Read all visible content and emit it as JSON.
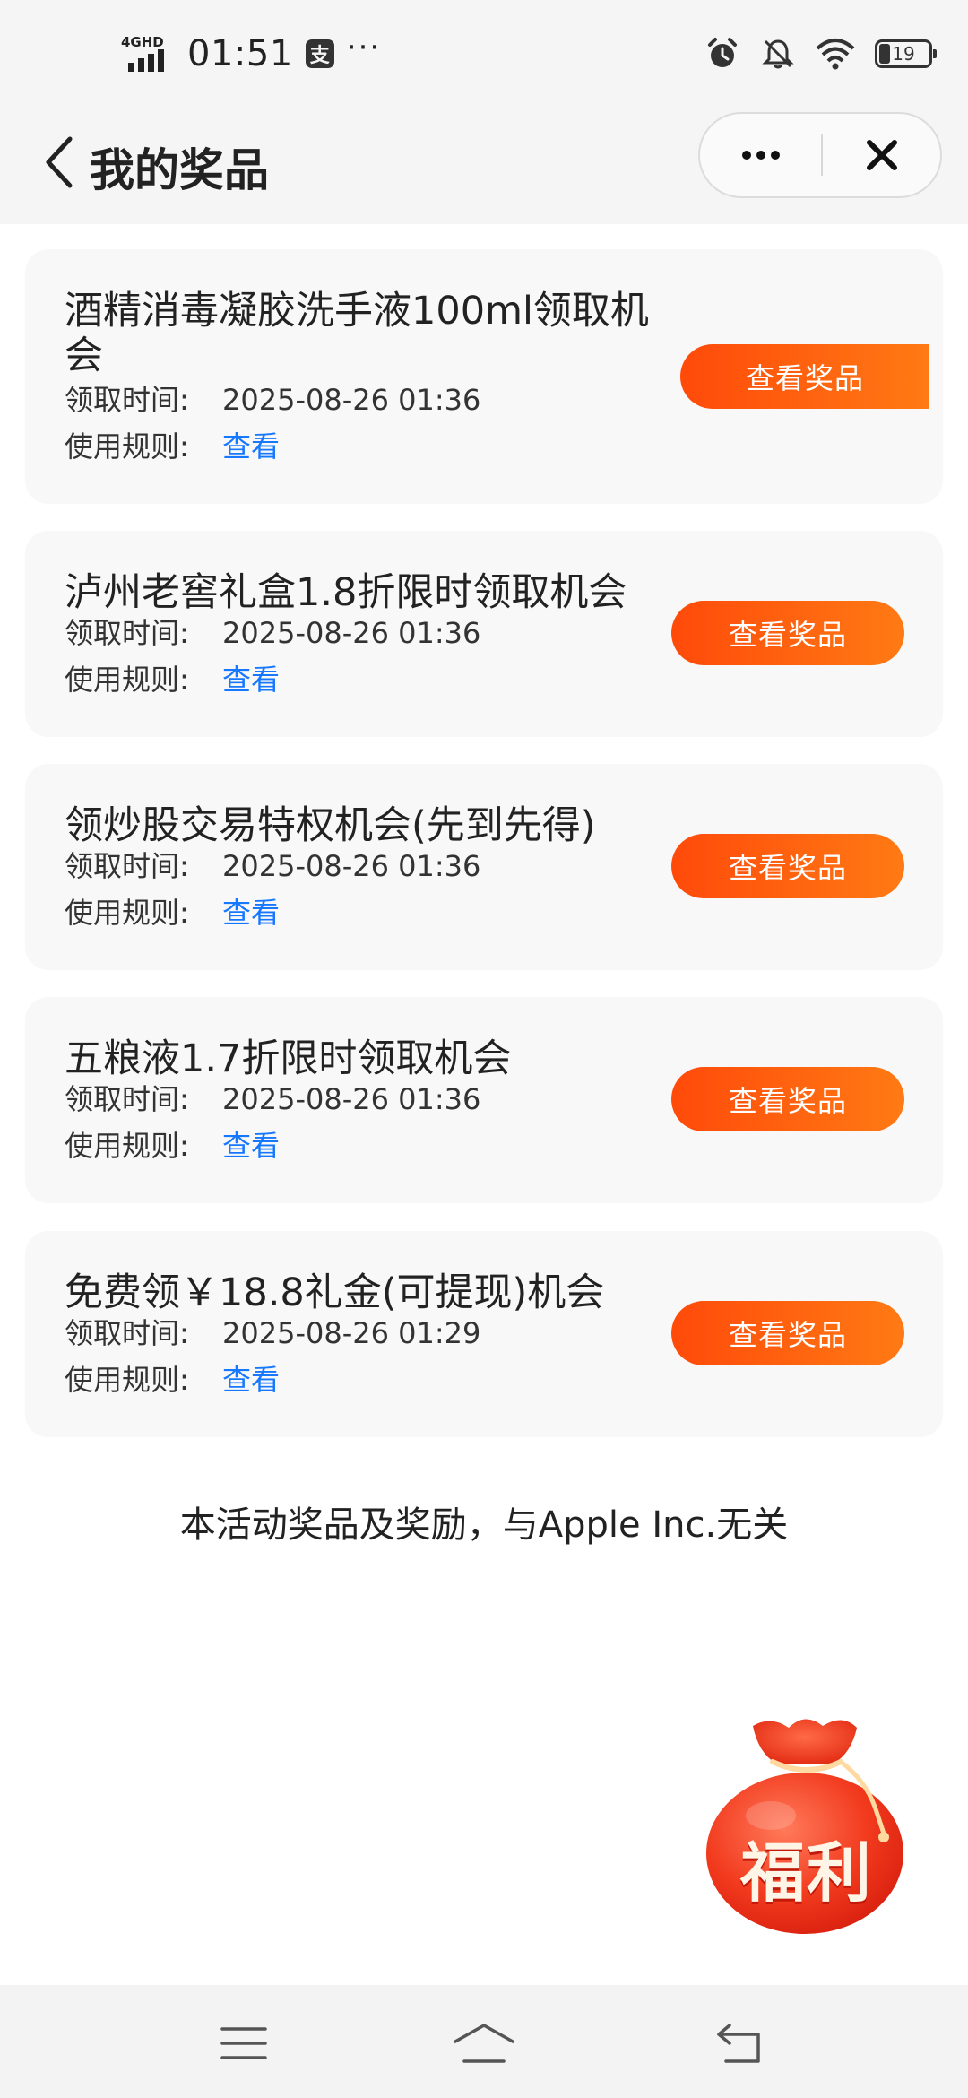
{
  "status_bar": {
    "network_label": "4GHD",
    "time": "01:51",
    "app_badge": "支",
    "more": "···",
    "battery": "19"
  },
  "nav": {
    "title": "我的奖品"
  },
  "prize_list": [
    {
      "name": "酒精消毒凝胶洗手液100ml领取机会",
      "time_label": "领取时间:",
      "time_value": "2025-08-26 01:36",
      "rule_label": "使用规则:",
      "rule_link": "查看",
      "button": "查看奖品"
    },
    {
      "name": "泸州老窖礼盒1.8折限时领取机会",
      "time_label": "领取时间:",
      "time_value": "2025-08-26 01:36",
      "rule_label": "使用规则:",
      "rule_link": "查看",
      "button": "查看奖品"
    },
    {
      "name": "领炒股交易特权机会(先到先得)",
      "time_label": "领取时间:",
      "time_value": "2025-08-26 01:36",
      "rule_label": "使用规则:",
      "rule_link": "查看",
      "button": "查看奖品"
    },
    {
      "name": "五粮液1.7折限时领取机会",
      "time_label": "领取时间:",
      "time_value": "2025-08-26 01:36",
      "rule_label": "使用规则:",
      "rule_link": "查看",
      "button": "查看奖品"
    },
    {
      "name": "免费领￥18.8礼金(可提现)机会",
      "time_label": "领取时间:",
      "time_value": "2025-08-26 01:29",
      "rule_label": "使用规则:",
      "rule_link": "查看",
      "button": "查看奖品"
    }
  ],
  "disclaimer": "本活动奖品及奖励，与Apple Inc.无关",
  "floating_bag": {
    "label": "福利"
  },
  "colors": {
    "accent": "#ff5a0f",
    "link": "#1677ff",
    "card_bg": "#f8f8f8",
    "header_bg": "#f5f5f5"
  },
  "icons": {
    "status_right": [
      "alarm-icon",
      "bell-muted-icon",
      "wifi-icon",
      "battery-icon"
    ],
    "nav": [
      "back-arrow-icon",
      "more-icon",
      "close-icon"
    ],
    "system_nav": [
      "menu-icon",
      "home-icon",
      "back-icon"
    ]
  }
}
